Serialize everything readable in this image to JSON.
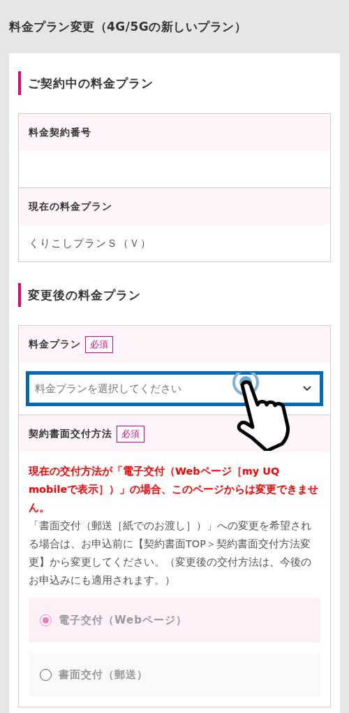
{
  "title": "料金プラン変更（4G/5Gの新しいプラン）",
  "sections": [
    {
      "heading": "ご契約中の料金プラン",
      "rows": [
        {
          "kind": "info",
          "label": "料金契約番号"
        },
        {
          "kind": "info",
          "label": "現在の料金プラン",
          "value": "くりこしプランＳ（Ｖ）"
        }
      ]
    },
    {
      "heading": "変更後の料金プラン",
      "rows": [
        {
          "kind": "select",
          "label": "料金プラン",
          "badge": "必須",
          "placeholder": "料金プランを選択してください",
          "focused": true
        },
        {
          "kind": "radio",
          "label": "契約書面交付方法",
          "badge": "必須",
          "warning": "現在の交付方法が「電子交付（Webページ［my UQ mobileで表示］）」の場合、このページからは変更できません。",
          "note": "「書面交付（郵送［紙でのお渡し］）」への変更を希望される場合は、お申込前に【契約書面TOP＞契約書面交付方法変更】から変更してください。（変更後の交付方法は、今後のお申込みにも適用されます。）",
          "options": [
            {
              "label": "電子交付（Webページ）",
              "selected": true,
              "disabled": true
            },
            {
              "label": "書面交付（郵送）",
              "selected": false,
              "disabled": true
            }
          ]
        }
      ]
    }
  ]
}
